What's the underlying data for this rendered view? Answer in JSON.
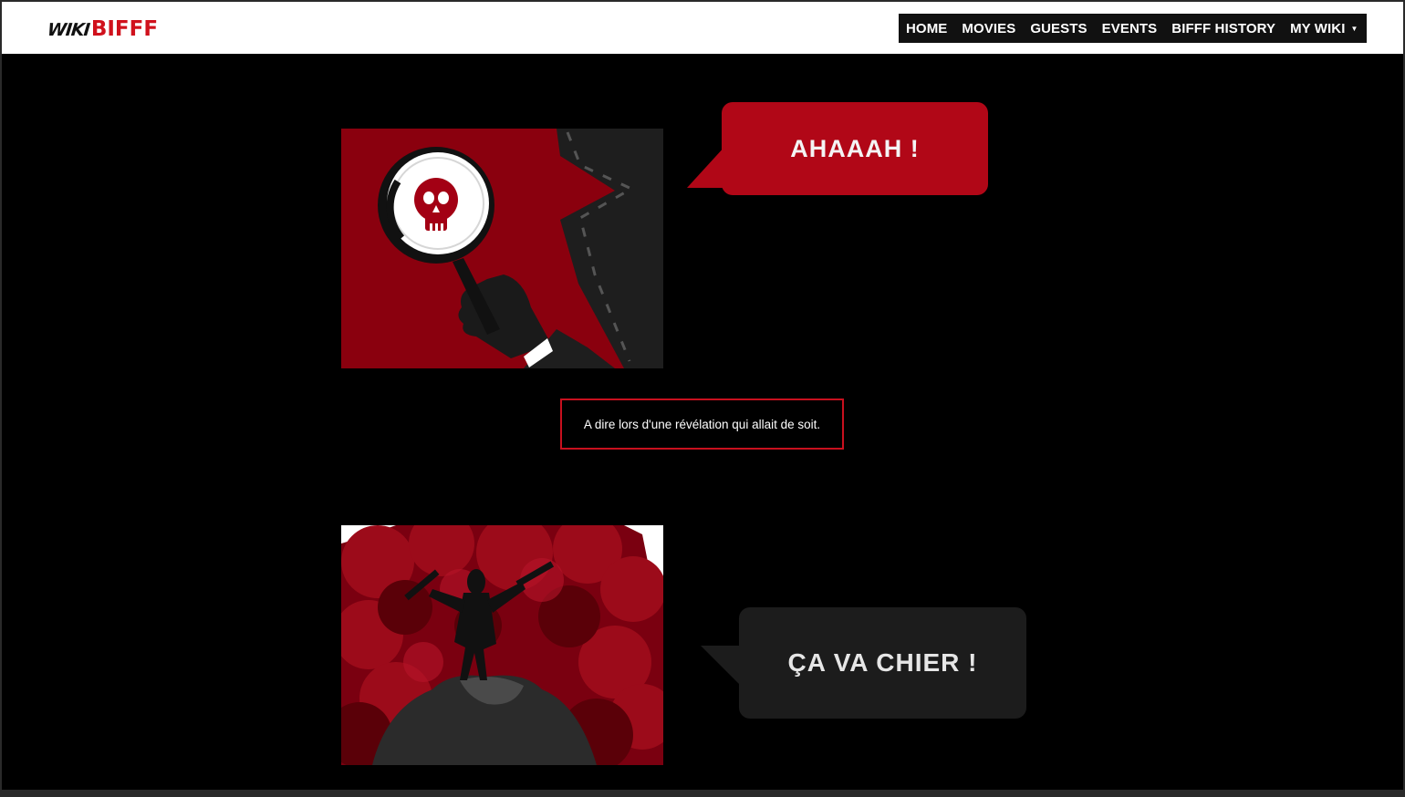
{
  "header": {
    "logo": {
      "wiki": "WIKI",
      "bifff": "BIFFF"
    },
    "nav": [
      {
        "label": "HOME"
      },
      {
        "label": "MOVIES"
      },
      {
        "label": "GUESTS"
      },
      {
        "label": "EVENTS"
      },
      {
        "label": "BIFFF HISTORY"
      },
      {
        "label": "MY WIKI"
      }
    ],
    "dropdown_icon": "caret-down-icon"
  },
  "entries": [
    {
      "illustration": "magnifying-glass-skull",
      "bubble_text": "AHAAAH !",
      "bubble_color": "#b10717",
      "caption": "A dire lors d'une révélation qui allait de soit."
    },
    {
      "illustration": "gunman-on-rock-smoke",
      "bubble_text": "ÇA VA CHIER !",
      "bubble_color": "#1c1c1c"
    }
  ],
  "colors": {
    "brand_red": "#d0111c",
    "panel_red": "#8a000e",
    "background": "#000000",
    "nav_bg": "#111111"
  }
}
